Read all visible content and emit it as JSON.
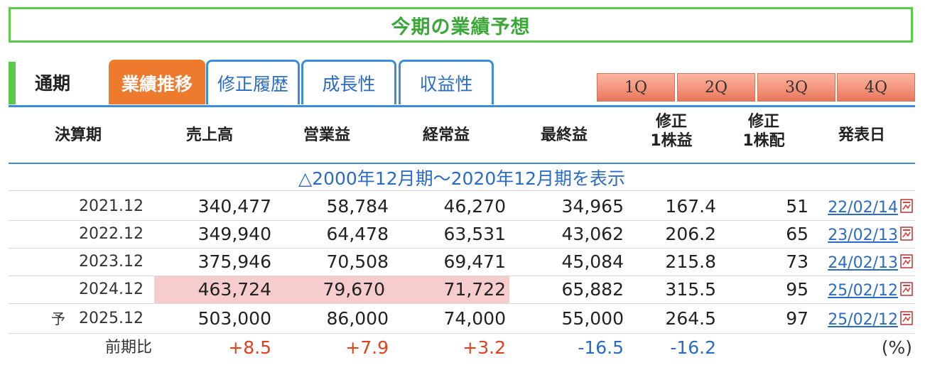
{
  "title": "今期の業績予想",
  "tabs": {
    "static_label": "通期",
    "items": [
      {
        "label": "業績推移",
        "active": true
      },
      {
        "label": "修正履歴",
        "active": false
      },
      {
        "label": "成長性",
        "active": false
      },
      {
        "label": "収益性",
        "active": false
      }
    ],
    "quarters": [
      "1Q",
      "2Q",
      "3Q",
      "4Q"
    ]
  },
  "table": {
    "headers": {
      "period": "決算期",
      "sales": "売上高",
      "operating": "営業益",
      "ordinary": "経常益",
      "net": "最終益",
      "eps_l1": "修正",
      "eps_l2": "1株益",
      "dps_l1": "修正",
      "dps_l2": "1株配",
      "date": "発表日"
    },
    "history_link": "△2000年12月期～2020年12月期を表示",
    "rows": [
      {
        "mark": "",
        "period": "2021.12",
        "sales": "340,477",
        "operating": "58,784",
        "ordinary": "46,270",
        "net": "34,965",
        "eps": "167.4",
        "dps": "51",
        "date": "22/02/14"
      },
      {
        "mark": "",
        "period": "2022.12",
        "sales": "349,940",
        "operating": "64,478",
        "ordinary": "63,531",
        "net": "43,062",
        "eps": "206.2",
        "dps": "65",
        "date": "23/02/13"
      },
      {
        "mark": "",
        "period": "2023.12",
        "sales": "375,946",
        "operating": "70,508",
        "ordinary": "69,471",
        "net": "45,084",
        "eps": "215.8",
        "dps": "73",
        "date": "24/02/13"
      },
      {
        "mark": "",
        "period": "2024.12",
        "sales": "463,724",
        "operating": "79,670",
        "ordinary": "71,722",
        "net": "65,882",
        "eps": "315.5",
        "dps": "95",
        "date": "25/02/12"
      },
      {
        "mark": "予",
        "period": "2025.12",
        "sales": "503,000",
        "operating": "86,000",
        "ordinary": "74,000",
        "net": "55,000",
        "eps": "264.5",
        "dps": "97",
        "date": "25/02/12"
      }
    ],
    "comparison": {
      "label": "前期比",
      "sales": "+8.5",
      "operating": "+7.9",
      "ordinary": "+3.2",
      "net": "-16.5",
      "eps": "-16.2",
      "unit": "(%)"
    }
  },
  "colors": {
    "accent_green": "#5ac94c",
    "tab_blue": "#3b8edc",
    "active_orange": "#ee7a2e",
    "highlight_pink": "#f7cccc",
    "positive_red": "#e2411e",
    "negative_blue": "#2a6bc4"
  },
  "icons": {
    "date_doc": "pdf-icon"
  }
}
